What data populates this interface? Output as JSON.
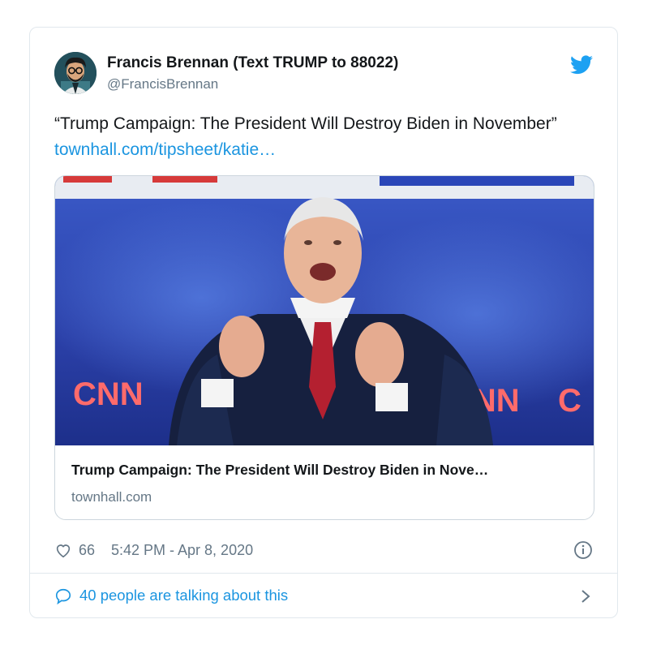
{
  "tweet": {
    "author_name": "Francis Brennan (Text TRUMP to 88022)",
    "author_handle": "@FrancisBrennan",
    "text_lead": "“Trump Campaign: The President Will Destroy Biden in November”",
    "text_link": "townhall.com/tipsheet/katie…",
    "card": {
      "image_alt": "Joe Biden speaking at CNN debate stage",
      "image_text_left": "CNN",
      "image_text_right": "CNN",
      "title": "Trump Campaign: The President Will Destroy Biden in Nove…",
      "domain": "townhall.com"
    },
    "likes": "66",
    "timestamp": "5:42 PM - Apr 8, 2020",
    "talking": "40 people are talking about this"
  },
  "colors": {
    "link": "#1b95e0",
    "muted": "#657786",
    "border": "#e1e8ed",
    "twitter_blue": "#1da1f2"
  },
  "icons": [
    "twitter-bird-icon",
    "heart-icon",
    "info-icon",
    "speech-bubble-icon",
    "chevron-right-icon"
  ]
}
